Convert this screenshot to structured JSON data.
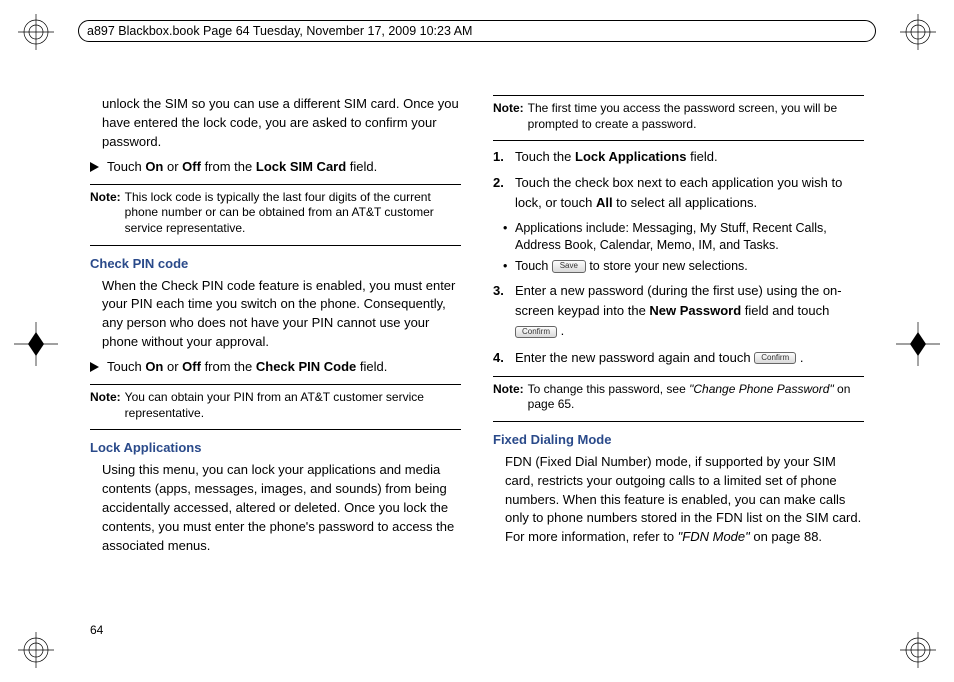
{
  "header": "a897 Blackbox.book  Page 64  Tuesday, November 17, 2009  10:23 AM",
  "page_number": "64",
  "left": {
    "intro": "unlock the SIM so you can use a different SIM card. Once you have entered the lock code, you are asked to confirm your password.",
    "step_lock_sim_pre": "Touch ",
    "on": "On",
    "or": " or ",
    "off": "Off",
    "from_the": " from the ",
    "lock_sim_field": "Lock SIM Card",
    "field_suffix": " field.",
    "note1_label": "Note:",
    "note1_text": "This lock code is typically the last four digits of the current phone number or can be obtained from an AT&T customer service representative.",
    "h_check_pin": "Check PIN code",
    "check_pin_para": "When the Check PIN code feature is enabled, you must enter your PIN each time you switch on the phone. Consequently, any person who does not have your PIN cannot use your phone without your approval.",
    "check_pin_field": "Check PIN Code",
    "note2_label": "Note:",
    "note2_text": "You can obtain your PIN from an AT&T customer service representative.",
    "h_lock_apps": "Lock Applications",
    "lock_apps_para": "Using this menu, you can lock your applications and media contents (apps, messages, images, and sounds) from being accidentally accessed, altered or deleted. Once you lock the contents, you must enter the phone's password to access the associated menus."
  },
  "right": {
    "note_top_label": "Note:",
    "note_top_text": "The first time you access the password screen, you will be prompted to create a password.",
    "step1_pre": "Touch the ",
    "step1_bold": "Lock Applications",
    "step1_post": " field.",
    "step2_pre": "Touch the check box next to each application you wish to lock, or touch ",
    "step2_bold": "All",
    "step2_post": " to select all applications.",
    "bullet1": "Applications include: Messaging, My Stuff, Recent Calls, Address Book, Calendar, Memo, IM, and Tasks.",
    "bullet2_pre": "Touch ",
    "save_btn": "Save",
    "bullet2_post": " to store your new selections.",
    "step3_pre": "Enter a new password (during the first use) using the on-screen keypad into the ",
    "step3_bold": "New Password",
    "step3_post": " field and touch ",
    "confirm_btn": "Confirm",
    "step4_pre": "Enter the new password again and touch ",
    "note_bottom_label": "Note:",
    "note_bottom_pre": "To change this password, see ",
    "note_bottom_italic": "\"Change Phone Password\"",
    "note_bottom_post": " on page 65.",
    "h_fdn": "Fixed Dialing Mode",
    "fdn_para_pre": "FDN (Fixed Dial Number) mode, if supported by your SIM card, restricts your outgoing calls to a limited set of phone numbers. When this feature is enabled, you can make calls only to phone numbers stored in the FDN list on the SIM card. For more information, refer to ",
    "fdn_italic": "\"FDN Mode\"",
    "fdn_para_post": "  on page 88."
  }
}
